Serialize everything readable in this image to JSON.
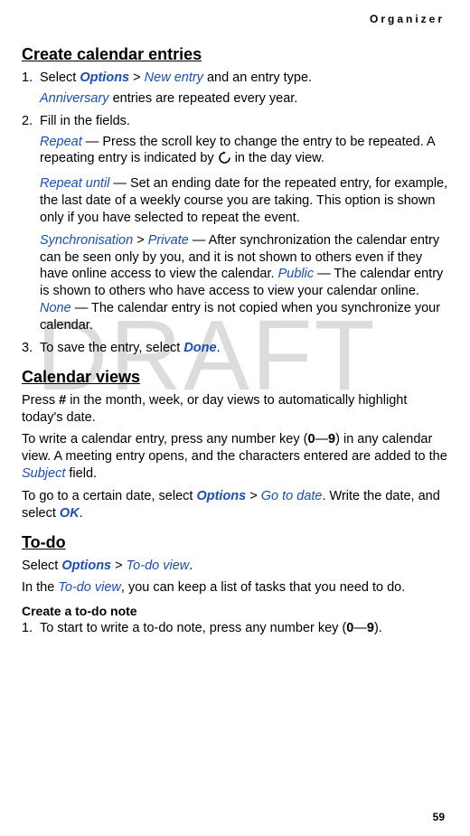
{
  "header": {
    "label": "Organizer"
  },
  "watermark": "DRAFT",
  "page_number": "59",
  "sections": {
    "create": {
      "heading": "Create calendar entries",
      "step1": {
        "num": "1.",
        "pre": "Select ",
        "options": "Options",
        "gt": " > ",
        "newentry": "New entry",
        "post": " and an entry type."
      },
      "anniv": {
        "label": "Anniversary",
        "post": " entries are repeated every year."
      },
      "step2": {
        "num": "2.",
        "text": "Fill in the fields."
      },
      "repeat": {
        "label": "Repeat",
        "text1": " — Press the scroll key to change the entry to be repeated. A repeating entry is indicated by ",
        "text2": " in the day view."
      },
      "repeat_until": {
        "label": "Repeat until",
        "text": " — Set an ending date for the repeated entry, for example, the last date of a weekly course you are taking. This option is shown only if you have selected to repeat the event."
      },
      "sync": {
        "label": "Synchronisation",
        "gt": " > ",
        "private": "Private",
        "text1": " — After synchronization the calendar entry can be seen only by you, and it is not shown to others even if they have online access to view the calendar. ",
        "public": "Public",
        "text2": " — The calendar entry is shown to others who have access to view your calendar online. ",
        "none": "None",
        "text3": " — The calendar entry is not copied when you synchronize your calendar."
      },
      "step3": {
        "num": "3.",
        "pre": "To save the entry, select ",
        "done": "Done",
        "post": "."
      }
    },
    "views": {
      "heading": "Calendar views",
      "p1a": "Press ",
      "p1hash": "#",
      "p1b": " in the month, week, or day views to automatically highlight today's date.",
      "p2a": "To write a calendar entry, press any number key (",
      "p2zero": "0",
      "p2dash": "—",
      "p2nine": "9",
      "p2b": ") in any calendar view. A meeting entry opens, and the characters entered are added to the ",
      "subject": "Subject",
      "p2c": " field.",
      "p3a": "To go to a certain date, select ",
      "options": "Options",
      "gt": " > ",
      "gotodate": "Go to date",
      "p3b": ". Write the date, and select ",
      "ok": "OK",
      "p3c": "."
    },
    "todo": {
      "heading": "To-do",
      "p1a": "Select ",
      "options": "Options",
      "gt": " > ",
      "todoview": "To-do view",
      "p1b": ".",
      "p2a": "In the ",
      "todoview2": "To-do view",
      "p2b": ", you can keep a list of tasks that you need to do.",
      "subheading": "Create a to-do note",
      "step1": {
        "num": "1.",
        "pre": "To start to write a to-do note, press any number key (",
        "zero": "0",
        "dash": "—",
        "nine": "9",
        "post": ")."
      }
    }
  }
}
